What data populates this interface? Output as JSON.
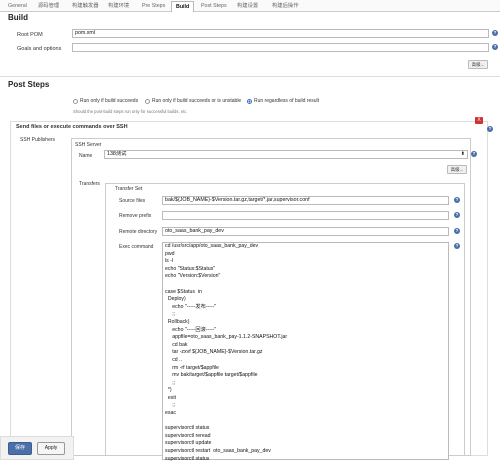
{
  "tabs": [
    "General",
    "源码管理",
    "构建触发器",
    "构建环境",
    "Pre Steps",
    "Build",
    "Post Steps",
    "构建设置",
    "构建后操作"
  ],
  "build": {
    "title": "Build",
    "root_pom_label": "Root POM",
    "root_pom_value": "pom.xml",
    "goals_label": "Goals and options",
    "goals_value": "",
    "advanced_label": "高级..."
  },
  "post_steps": {
    "title": "Post Steps",
    "radio1": "Run only if build succeeds",
    "radio2": "Run only if build succeeds or is unstable",
    "radio3": "Run regardless of build result",
    "note": "Should the post-build steps run only for successful builds, etc."
  },
  "ssh": {
    "section_title": "Send files or execute commands over SSH",
    "publishers_label": "SSH Publishers",
    "server_label": "SSH Server",
    "name_label": "Name",
    "name_value": "138测试",
    "advanced_label": "高级...",
    "transfers_label": "Transfers",
    "transfer_set_label": "Transfer Set",
    "source_files_label": "Source files",
    "source_files_value": "bak/${JOB_NAME}-$Version.tar.gz,target/*.jar,supervisor.conf",
    "remove_prefix_label": "Remove prefix",
    "remove_prefix_value": "",
    "remote_dir_label": "Remote directory",
    "remote_dir_value": "oto_saas_bank_pay_dev",
    "exec_label": "Exec command",
    "exec_lines": [
      "cd /usr/src/app/oto_saas_bank_pay_dev",
      "pwd",
      "ls -l",
      "echo \"Status:$Status\"",
      "echo \"Version:$Version\"",
      "",
      "case $Status  in",
      "  Deploy)",
      "     echo \"-----发布-----\"",
      "     ;;",
      "  Rollback)",
      "     echo \"-----回滚-----\"",
      "     appfile=oto_saas_bank_pay-1.1.2-SNAPSHOT.jar",
      "     cd bak",
      "     tar -zxvf ${JOB_NAME}-$Version.tar.gz",
      "     cd ..",
      "     rm -rf target/$appfile",
      "     mv bak/target/$appfile target/$appfile",
      "     ;;",
      "  *)",
      "  exit",
      "     ;;",
      "esac",
      "",
      "supervisorctl status",
      "supervisorctl reread",
      "supervisorctl update",
      "supervisorctl restart  oto_saas_bank_pay_dev",
      "supervisorctl status"
    ]
  },
  "footer": {
    "save": "保存",
    "apply": "Apply"
  },
  "colors": {
    "help": "#4a6ea9",
    "delete": "#cc3333",
    "save": "#4b6fa8"
  }
}
